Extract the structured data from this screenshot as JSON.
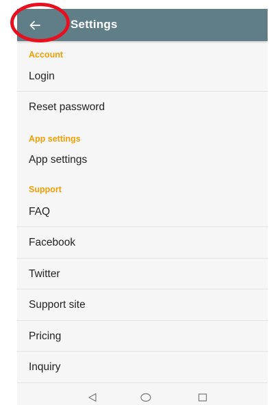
{
  "appbar": {
    "title": "Settings",
    "back_icon": "arrow-back-icon",
    "color": "#5f7e88"
  },
  "sections": [
    {
      "header": "Account",
      "items": [
        "Login",
        "Reset password"
      ]
    },
    {
      "header": "App settings",
      "items": [
        "App settings"
      ]
    },
    {
      "header": "Support",
      "items": [
        "FAQ",
        "Facebook",
        "Twitter",
        "Support site",
        "Pricing",
        "Inquiry"
      ]
    }
  ],
  "navbar": {
    "icons": [
      "back-triangle-icon",
      "home-circle-icon",
      "recents-square-icon"
    ]
  },
  "colors": {
    "accent": "#f29f05",
    "annotation": "#e8101e"
  }
}
